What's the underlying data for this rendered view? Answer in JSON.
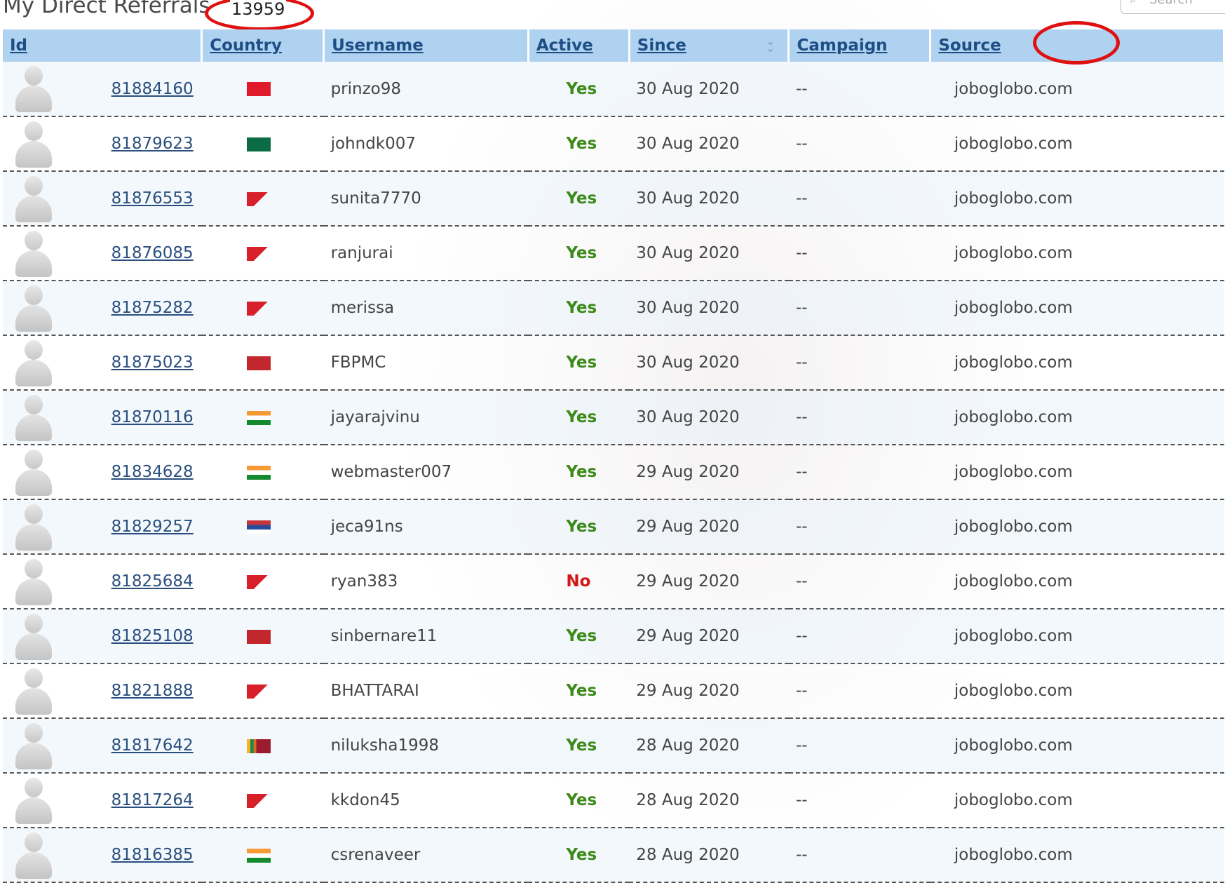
{
  "header": {
    "title": "My Direct Referrals",
    "count": "13959",
    "search_placeholder": "Search"
  },
  "columns": [
    "Id",
    "Country",
    "Username",
    "Active",
    "Since",
    "Campaign",
    "Source"
  ],
  "colors": {
    "header_bg": "#aed2ef",
    "header_text": "#1e4e85",
    "link": "#2a4f7f",
    "active_yes": "#3c8a1a",
    "active_no": "#d01818",
    "annotation": "#e01010"
  },
  "rows": [
    {
      "id": "81884160",
      "flag": "tunisia-flag",
      "username": "prinzo98",
      "active": "Yes",
      "since": "30 Aug 2020",
      "campaign": "--",
      "source": "joboglobo.com"
    },
    {
      "id": "81879623",
      "flag": "bangladesh-flag",
      "username": "johndk007",
      "active": "Yes",
      "since": "30 Aug 2020",
      "campaign": "--",
      "source": "joboglobo.com"
    },
    {
      "id": "81876553",
      "flag": "nepal-flag",
      "username": "sunita7770",
      "active": "Yes",
      "since": "30 Aug 2020",
      "campaign": "--",
      "source": "joboglobo.com"
    },
    {
      "id": "81876085",
      "flag": "nepal-flag",
      "username": "ranjurai",
      "active": "Yes",
      "since": "30 Aug 2020",
      "campaign": "--",
      "source": "joboglobo.com"
    },
    {
      "id": "81875282",
      "flag": "nepal-flag",
      "username": "merissa",
      "active": "Yes",
      "since": "30 Aug 2020",
      "campaign": "--",
      "source": "joboglobo.com"
    },
    {
      "id": "81875023",
      "flag": "morocco-flag",
      "username": "FBPMC",
      "active": "Yes",
      "since": "30 Aug 2020",
      "campaign": "--",
      "source": "joboglobo.com"
    },
    {
      "id": "81870116",
      "flag": "india-flag",
      "username": "jayarajvinu",
      "active": "Yes",
      "since": "30 Aug 2020",
      "campaign": "--",
      "source": "joboglobo.com"
    },
    {
      "id": "81834628",
      "flag": "india-flag",
      "username": "webmaster007",
      "active": "Yes",
      "since": "29 Aug 2020",
      "campaign": "--",
      "source": "joboglobo.com"
    },
    {
      "id": "81829257",
      "flag": "serbia-flag",
      "username": "jeca91ns",
      "active": "Yes",
      "since": "29 Aug 2020",
      "campaign": "--",
      "source": "joboglobo.com"
    },
    {
      "id": "81825684",
      "flag": "nepal-flag",
      "username": "ryan383",
      "active": "No",
      "since": "29 Aug 2020",
      "campaign": "--",
      "source": "joboglobo.com"
    },
    {
      "id": "81825108",
      "flag": "morocco-flag",
      "username": "sinbernare11",
      "active": "Yes",
      "since": "29 Aug 2020",
      "campaign": "--",
      "source": "joboglobo.com"
    },
    {
      "id": "81821888",
      "flag": "nepal-flag",
      "username": "BHATTARAI",
      "active": "Yes",
      "since": "29 Aug 2020",
      "campaign": "--",
      "source": "joboglobo.com"
    },
    {
      "id": "81817642",
      "flag": "sri-lanka-flag",
      "username": "niluksha1998",
      "active": "Yes",
      "since": "28 Aug 2020",
      "campaign": "--",
      "source": "joboglobo.com"
    },
    {
      "id": "81817264",
      "flag": "nepal-flag",
      "username": "kkdon45",
      "active": "Yes",
      "since": "28 Aug 2020",
      "campaign": "--",
      "source": "joboglobo.com"
    },
    {
      "id": "81816385",
      "flag": "india-flag",
      "username": "csrenaveer",
      "active": "Yes",
      "since": "28 Aug 2020",
      "campaign": "--",
      "source": "joboglobo.com"
    }
  ]
}
